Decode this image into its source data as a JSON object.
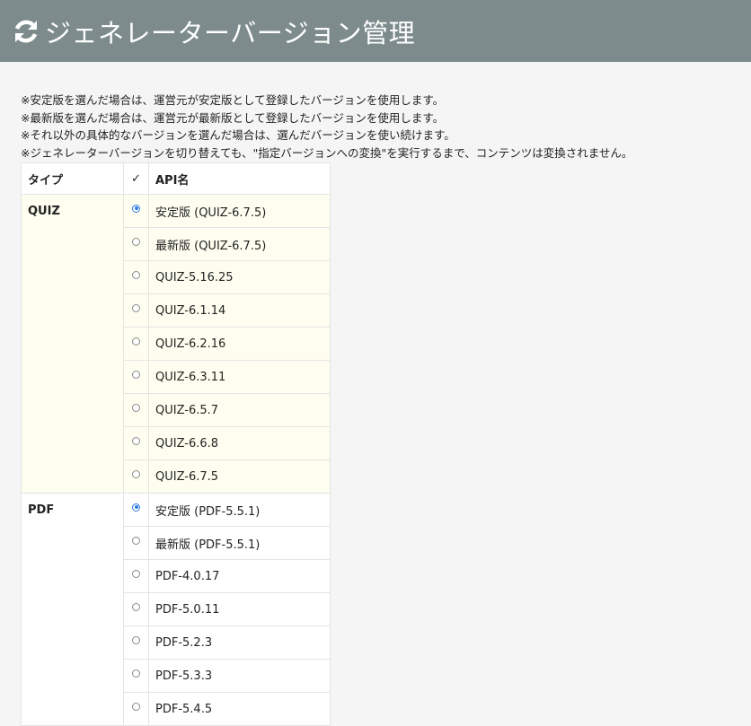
{
  "header": {
    "title": "ジェネレーターバージョン管理",
    "icon": "refresh-icon"
  },
  "notes": [
    "※安定版を選んだ場合は、運営元が安定版として登録したバージョンを使用します。",
    "※最新版を選んだ場合は、運営元が最新版として登録したバージョンを使用します。",
    "※それ以外の具体的なバージョンを選んだ場合は、選んだバージョンを使い続けます。",
    "※ジェネレーターバージョンを切り替えても、\"指定バージョンへの変換\"を実行するまで、コンテンツは変換されません。"
  ],
  "table": {
    "headers": {
      "type": "タイプ",
      "check": "✓",
      "api": "API名"
    },
    "groups": [
      {
        "type": "QUIZ",
        "options": [
          {
            "label": "安定版 (QUIZ-6.7.5)",
            "checked": true
          },
          {
            "label": "最新版 (QUIZ-6.7.5)",
            "checked": false
          },
          {
            "label": "QUIZ-5.16.25",
            "checked": false
          },
          {
            "label": "QUIZ-6.1.14",
            "checked": false
          },
          {
            "label": "QUIZ-6.2.16",
            "checked": false
          },
          {
            "label": "QUIZ-6.3.11",
            "checked": false
          },
          {
            "label": "QUIZ-6.5.7",
            "checked": false
          },
          {
            "label": "QUIZ-6.6.8",
            "checked": false
          },
          {
            "label": "QUIZ-6.7.5",
            "checked": false
          }
        ]
      },
      {
        "type": "PDF",
        "options": [
          {
            "label": "安定版 (PDF-5.5.1)",
            "checked": true
          },
          {
            "label": "最新版 (PDF-5.5.1)",
            "checked": false
          },
          {
            "label": "PDF-4.0.17",
            "checked": false
          },
          {
            "label": "PDF-5.0.11",
            "checked": false
          },
          {
            "label": "PDF-5.2.3",
            "checked": false
          },
          {
            "label": "PDF-5.3.3",
            "checked": false
          },
          {
            "label": "PDF-5.4.5",
            "checked": false
          }
        ]
      }
    ]
  },
  "colors": {
    "header_bg": "#7d8b8c",
    "quiz_row_bg": "#fefef0",
    "radio_checked": "#2a7be4"
  }
}
